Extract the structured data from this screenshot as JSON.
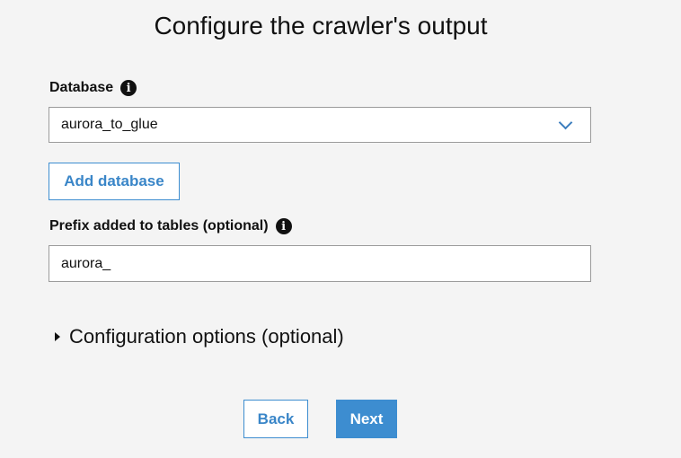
{
  "page": {
    "title": "Configure the crawler's output"
  },
  "database": {
    "label": "Database",
    "selected": "aurora_to_glue",
    "info_icon": "info-icon",
    "dropdown_icon": "chevron-down-icon"
  },
  "add_database": {
    "label": "Add database"
  },
  "prefix": {
    "label": "Prefix added to tables (optional)",
    "value": "aurora_",
    "info_icon": "info-icon"
  },
  "config_options": {
    "label": "Configuration options (optional)",
    "expanded": false,
    "icon": "caret-right-icon"
  },
  "footer": {
    "back_label": "Back",
    "next_label": "Next"
  },
  "colors": {
    "accent": "#3d8dd0",
    "background": "#f4f4f4"
  }
}
